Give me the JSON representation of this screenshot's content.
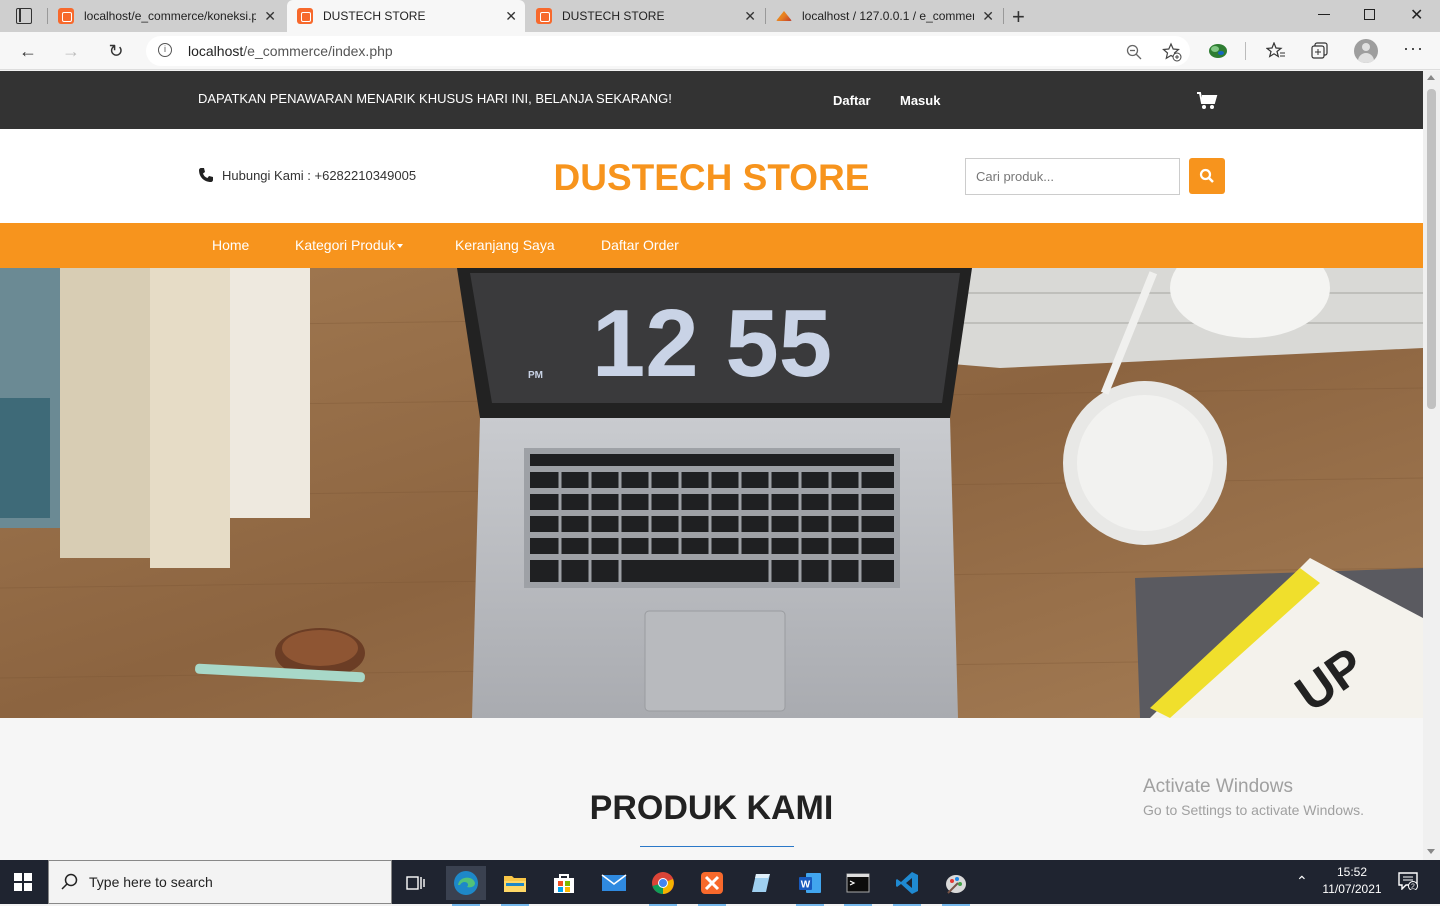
{
  "browser": {
    "tabs": [
      {
        "title": "localhost/e_commerce/koneksi.p",
        "active": false,
        "favicon": "xampp-icon"
      },
      {
        "title": "DUSTECH STORE",
        "active": true,
        "favicon": "xampp-icon"
      },
      {
        "title": "DUSTECH STORE",
        "active": false,
        "favicon": "xampp-icon"
      },
      {
        "title": "localhost / 127.0.0.1 / e_commer",
        "active": false,
        "favicon": "phpmyadmin-icon"
      }
    ],
    "url_host": "localhost",
    "url_path": "/e_commerce/index.php"
  },
  "topbar": {
    "promo": "DAPATKAN PENAWARAN MENARIK KHUSUS HARI INI, BELANJA SEKARANG!",
    "register": "Daftar",
    "login": "Masuk"
  },
  "header": {
    "contact": "Hubungi Kami : +6282210349005",
    "brand": "DUSTECH STORE",
    "search_placeholder": "Cari produk..."
  },
  "nav": {
    "items": [
      {
        "label": "Home"
      },
      {
        "label": "Kategori Produk"
      },
      {
        "label": "Keranjang Saya"
      },
      {
        "label": "Daftar Order"
      }
    ]
  },
  "hero": {
    "laptop_clock": "12 55",
    "clock_ampm": "PM"
  },
  "section": {
    "title": "PRODUK KAMI"
  },
  "watermark": {
    "line1": "Activate Windows",
    "line2": "Go to Settings to activate Windows."
  },
  "taskbar": {
    "search_text": "Type here to search",
    "time": "15:52",
    "date": "11/07/2021"
  },
  "colors": {
    "brand_orange": "#f7941d",
    "topbar_dark": "#333333"
  }
}
